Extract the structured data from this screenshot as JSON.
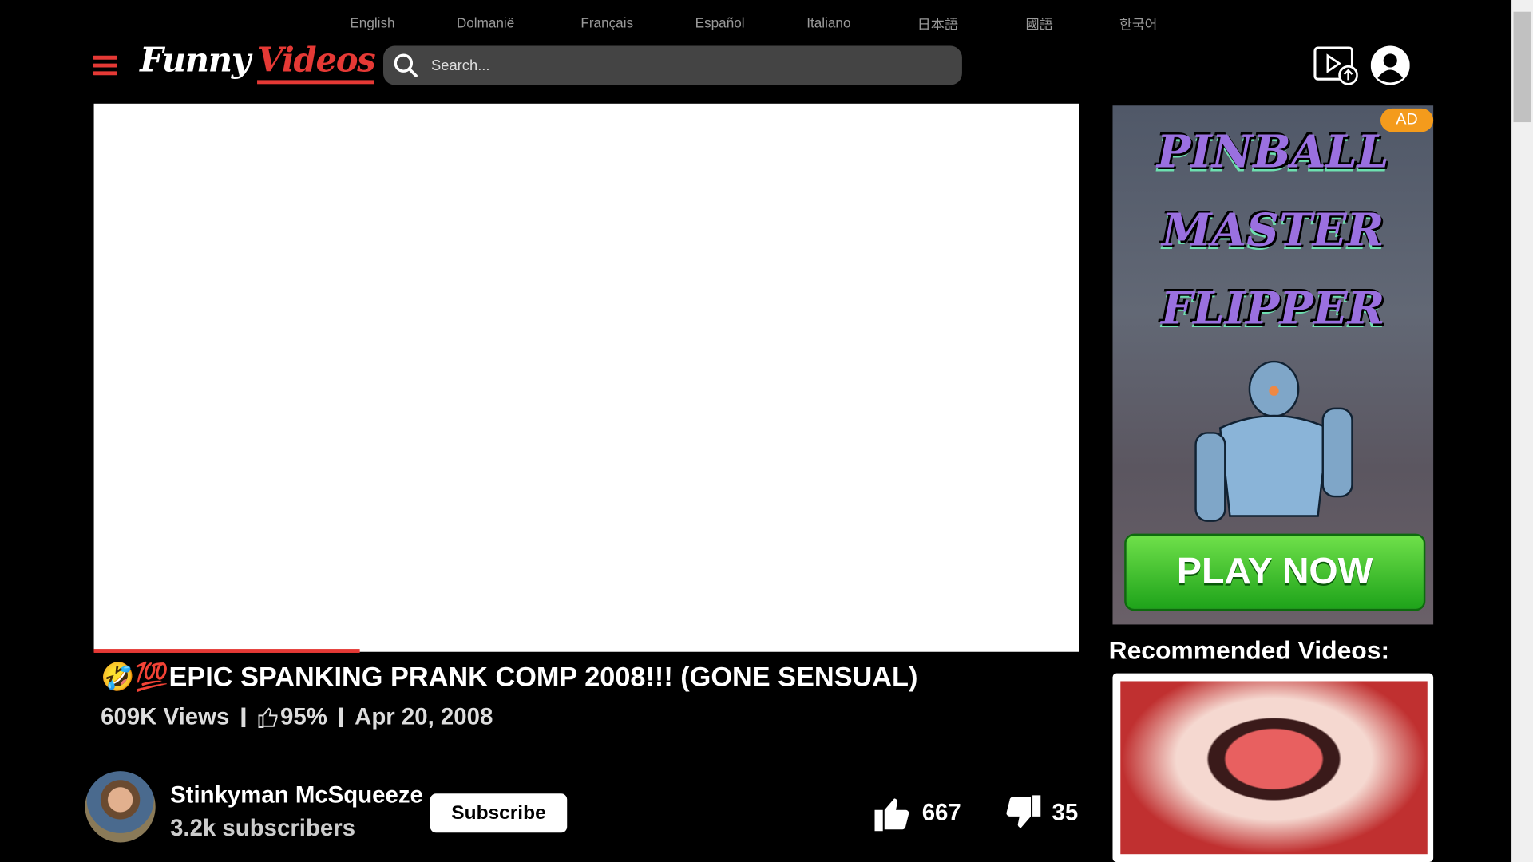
{
  "languages": [
    "English",
    "Dolmanië",
    "Français",
    "Español",
    "Italiano",
    "日本語",
    "國語",
    "한국어"
  ],
  "logo": {
    "part1": "Funny",
    "part2": "Videos"
  },
  "search": {
    "placeholder": "Search..."
  },
  "video": {
    "progress_percent": 27,
    "title": "🤣💯EPIC SPANKING PRANK COMP 2008!!! (GONE SENSUAL)",
    "views": "609K Views",
    "rating": "95%",
    "date": "Apr 20, 2008"
  },
  "channel": {
    "name": "Stinkyman McSqueeze",
    "subscribers": "3.2k subscribers",
    "subscribe_label": "Subscribe"
  },
  "votes": {
    "likes": "667",
    "dislikes": "35"
  },
  "ad": {
    "badge": "AD",
    "title_lines": [
      "PINBALL",
      "MASTER",
      "FLIPPER"
    ],
    "cta": "PLAY NOW"
  },
  "recommended": {
    "heading": "Recommended Videos:"
  },
  "colors": {
    "accent": "#e53935",
    "ad_badge": "#f49b1c"
  }
}
